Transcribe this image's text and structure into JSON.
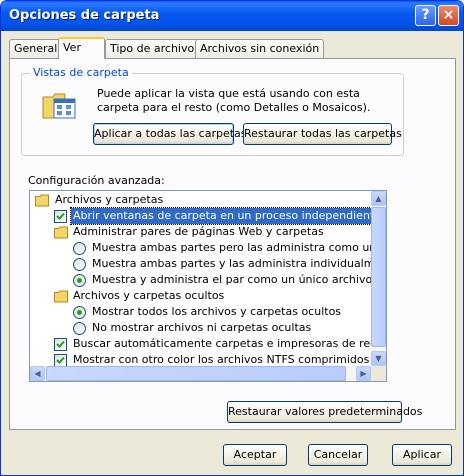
{
  "window": {
    "title": "Opciones de carpeta",
    "help_label": "?",
    "close_label": "×"
  },
  "tabs": [
    {
      "label": "General"
    },
    {
      "label": "Ver",
      "active": true
    },
    {
      "label": "Tipo de archivo"
    },
    {
      "label": "Archivos sin conexión"
    }
  ],
  "folder_views": {
    "title": "Vistas de carpeta",
    "description": "Puede aplicar la vista que está usando con esta carpeta para el resto (como Detalles o Mosaicos).",
    "apply_all_label": "Aplicar a todas las carpetas",
    "reset_all_label": "Restaurar todas las carpetas"
  },
  "advanced": {
    "title": "Configuración avanzada:",
    "items": [
      {
        "type": "folder",
        "label": "Archivos y carpetas"
      },
      {
        "type": "checkbox",
        "checked": true,
        "selected": true,
        "label": "Abrir ventanas de carpeta  en un proceso independiente"
      },
      {
        "type": "folder",
        "label": "Administrar pares de páginas Web y carpetas"
      },
      {
        "type": "radio",
        "checked": false,
        "label": "Muestra ambas partes pero las administra como un único arch"
      },
      {
        "type": "radio",
        "checked": false,
        "label": "Muestra ambas partes y las administra individualmente"
      },
      {
        "type": "radio",
        "checked": true,
        "label": "Muestra y administra el par como un único archivo"
      },
      {
        "type": "folder",
        "label": "Archivos y carpetas ocultos"
      },
      {
        "type": "radio",
        "checked": true,
        "label": "Mostrar todos los archivos y carpetas ocultos"
      },
      {
        "type": "radio",
        "checked": false,
        "label": "No mostrar archivos ni carpetas ocultas"
      },
      {
        "type": "checkbox",
        "checked": true,
        "label": "Buscar automáticamente carpetas e impresoras de red"
      },
      {
        "type": "checkbox",
        "checked": true,
        "label": "Mostrar con otro color los archivos NTFS comprimidos o cifrados"
      }
    ],
    "restore_defaults_label": "Restaurar valores predeterminados"
  },
  "footer": {
    "ok_label": "Aceptar",
    "cancel_label": "Cancelar",
    "apply_label": "Aplicar"
  },
  "colors": {
    "title_bar": "#0058ee",
    "selection": "#316ac5",
    "radio_dot": "#21a121",
    "group_title": "#0046d5"
  }
}
